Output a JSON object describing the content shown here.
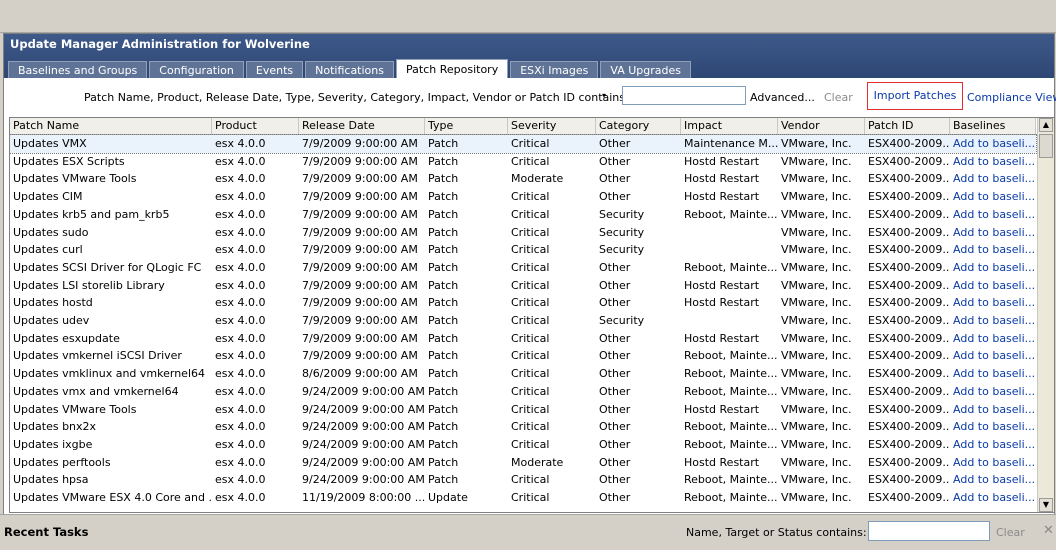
{
  "window": {
    "title": "Update Manager Administration for Wolverine"
  },
  "tabs": [
    {
      "label": "Baselines and Groups",
      "active": false
    },
    {
      "label": "Configuration",
      "active": false
    },
    {
      "label": "Events",
      "active": false
    },
    {
      "label": "Notifications",
      "active": false
    },
    {
      "label": "Patch Repository",
      "active": true
    },
    {
      "label": "ESXi Images",
      "active": false
    },
    {
      "label": "VA Upgrades",
      "active": false
    }
  ],
  "filter": {
    "label": "Patch Name, Product, Release Date, Type, Severity, Category, Impact, Vendor or Patch ID contains:",
    "dropdown_icon": "▾",
    "value": "",
    "advanced": "Advanced...",
    "clear": "Clear",
    "import_patches": "Import Patches",
    "compliance_view": "Compliance View",
    "highlight_color": "#e03030"
  },
  "table": {
    "columns": [
      "Patch Name",
      "Product",
      "Release Date",
      "Type",
      "Severity",
      "Category",
      "Impact",
      "Vendor",
      "Patch ID",
      "Baselines"
    ],
    "rows": [
      [
        "Updates VMX",
        "esx 4.0.0",
        "7/9/2009 9:00:00 AM",
        "Patch",
        "Critical",
        "Other",
        "Maintenance M...",
        "VMware, Inc.",
        "ESX400-2009...",
        "Add to baseli..."
      ],
      [
        "Updates ESX Scripts",
        "esx 4.0.0",
        "7/9/2009 9:00:00 AM",
        "Patch",
        "Critical",
        "Other",
        "Hostd Restart",
        "VMware, Inc.",
        "ESX400-2009...",
        "Add to baseli..."
      ],
      [
        "Updates VMware Tools",
        "esx 4.0.0",
        "7/9/2009 9:00:00 AM",
        "Patch",
        "Moderate",
        "Other",
        "Hostd Restart",
        "VMware, Inc.",
        "ESX400-2009...",
        "Add to baseli..."
      ],
      [
        "Updates CIM",
        "esx 4.0.0",
        "7/9/2009 9:00:00 AM",
        "Patch",
        "Critical",
        "Other",
        "Hostd Restart",
        "VMware, Inc.",
        "ESX400-2009...",
        "Add to baseli..."
      ],
      [
        "Updates krb5 and pam_krb5",
        "esx 4.0.0",
        "7/9/2009 9:00:00 AM",
        "Patch",
        "Critical",
        "Security",
        "Reboot, Mainte...",
        "VMware, Inc.",
        "ESX400-2009...",
        "Add to baseli..."
      ],
      [
        "Updates sudo",
        "esx 4.0.0",
        "7/9/2009 9:00:00 AM",
        "Patch",
        "Critical",
        "Security",
        "",
        "VMware, Inc.",
        "ESX400-2009...",
        "Add to baseli..."
      ],
      [
        "Updates curl",
        "esx 4.0.0",
        "7/9/2009 9:00:00 AM",
        "Patch",
        "Critical",
        "Security",
        "",
        "VMware, Inc.",
        "ESX400-2009...",
        "Add to baseli..."
      ],
      [
        "Updates SCSI Driver for QLogic FC",
        "esx 4.0.0",
        "7/9/2009 9:00:00 AM",
        "Patch",
        "Critical",
        "Other",
        "Reboot, Mainte...",
        "VMware, Inc.",
        "ESX400-2009...",
        "Add to baseli..."
      ],
      [
        "Updates LSI storelib Library",
        "esx 4.0.0",
        "7/9/2009 9:00:00 AM",
        "Patch",
        "Critical",
        "Other",
        "Hostd Restart",
        "VMware, Inc.",
        "ESX400-2009...",
        "Add to baseli..."
      ],
      [
        "Updates hostd",
        "esx 4.0.0",
        "7/9/2009 9:00:00 AM",
        "Patch",
        "Critical",
        "Other",
        "Hostd Restart",
        "VMware, Inc.",
        "ESX400-2009...",
        "Add to baseli..."
      ],
      [
        "Updates udev",
        "esx 4.0.0",
        "7/9/2009 9:00:00 AM",
        "Patch",
        "Critical",
        "Security",
        "",
        "VMware, Inc.",
        "ESX400-2009...",
        "Add to baseli..."
      ],
      [
        "Updates esxupdate",
        "esx 4.0.0",
        "7/9/2009 9:00:00 AM",
        "Patch",
        "Critical",
        "Other",
        "Hostd Restart",
        "VMware, Inc.",
        "ESX400-2009...",
        "Add to baseli..."
      ],
      [
        "Updates vmkernel iSCSI Driver",
        "esx 4.0.0",
        "7/9/2009 9:00:00 AM",
        "Patch",
        "Critical",
        "Other",
        "Reboot, Mainte...",
        "VMware, Inc.",
        "ESX400-2009...",
        "Add to baseli..."
      ],
      [
        "Updates vmklinux and vmkernel64",
        "esx 4.0.0",
        "8/6/2009 9:00:00 AM",
        "Patch",
        "Critical",
        "Other",
        "Reboot, Mainte...",
        "VMware, Inc.",
        "ESX400-2009...",
        "Add to baseli..."
      ],
      [
        "Updates vmx and vmkernel64",
        "esx 4.0.0",
        "9/24/2009 9:00:00 AM",
        "Patch",
        "Critical",
        "Other",
        "Reboot, Mainte...",
        "VMware, Inc.",
        "ESX400-2009...",
        "Add to baseli..."
      ],
      [
        "Updates VMware Tools",
        "esx 4.0.0",
        "9/24/2009 9:00:00 AM",
        "Patch",
        "Critical",
        "Other",
        "Hostd Restart",
        "VMware, Inc.",
        "ESX400-2009...",
        "Add to baseli..."
      ],
      [
        "Updates bnx2x",
        "esx 4.0.0",
        "9/24/2009 9:00:00 AM",
        "Patch",
        "Critical",
        "Other",
        "Reboot, Mainte...",
        "VMware, Inc.",
        "ESX400-2009...",
        "Add to baseli..."
      ],
      [
        "Updates ixgbe",
        "esx 4.0.0",
        "9/24/2009 9:00:00 AM",
        "Patch",
        "Critical",
        "Other",
        "Reboot, Mainte...",
        "VMware, Inc.",
        "ESX400-2009...",
        "Add to baseli..."
      ],
      [
        "Updates perftools",
        "esx 4.0.0",
        "9/24/2009 9:00:00 AM",
        "Patch",
        "Moderate",
        "Other",
        "Hostd Restart",
        "VMware, Inc.",
        "ESX400-2009...",
        "Add to baseli..."
      ],
      [
        "Updates hpsa",
        "esx 4.0.0",
        "9/24/2009 9:00:00 AM",
        "Patch",
        "Critical",
        "Other",
        "Reboot, Mainte...",
        "VMware, Inc.",
        "ESX400-2009...",
        "Add to baseli..."
      ],
      [
        "Updates VMware ESX 4.0 Core and ...",
        "esx 4.0.0",
        "11/19/2009 8:00:00 ...",
        "Update",
        "Critical",
        "Other",
        "Reboot, Mainte...",
        "VMware, Inc.",
        "ESX400-2009...",
        "Add to baseli..."
      ]
    ]
  },
  "scrollbar": {
    "up": "▲",
    "down": "▼"
  },
  "bottom": {
    "recent_tasks": "Recent Tasks",
    "filter_label": "Name, Target or Status contains:",
    "dropdown_icon": "▾",
    "clear": "Clear",
    "close": "✕"
  }
}
